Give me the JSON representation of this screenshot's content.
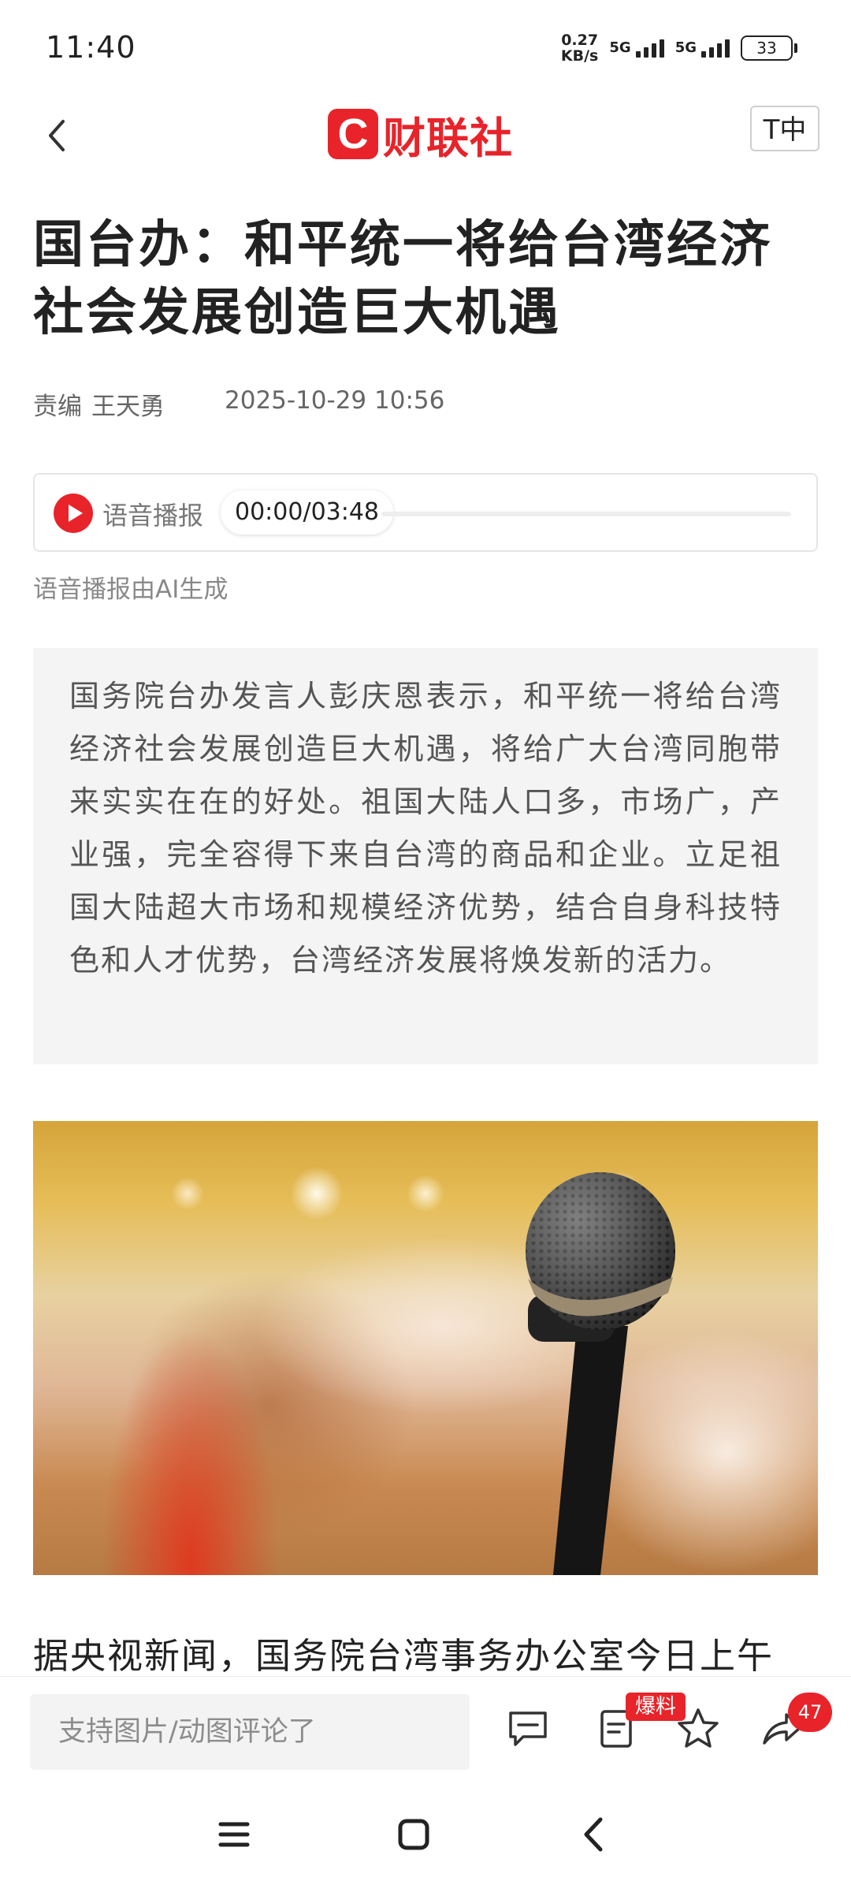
{
  "status_bar": {
    "time": "11:40",
    "net_speed_value": "0.27",
    "net_speed_unit": "KB/s",
    "sim1_label": "5G",
    "sim2_label": "5G",
    "battery": "33"
  },
  "header": {
    "logo_mark": "C",
    "logo_text": "财联社",
    "font_size_button": "T中"
  },
  "article": {
    "title": "国台办：和平统一将给台湾经济社会发展创造巨大机遇",
    "editor_label": "责编",
    "editor_name": "王天勇",
    "datetime": "2025-10-29 10:56",
    "audio": {
      "label": "语音播报",
      "time": "00:00/03:48",
      "progress": 0,
      "ai_note": "语音播报由AI生成"
    },
    "summary": "国务院台办发言人彭庆恩表示，和平统一将给台湾经济社会发展创造巨大机遇，将给广大台湾同胞带来实实在在的好处。祖国大陆人口多，市场广，产业强，完全容得下来自台湾的商品和企业。立足祖国大陆超大市场和规模经济优势，结合自身科技特色和人才优势，台湾经济发展将焕发新的活力。",
    "body_first_line": "据央视新闻，国务院台湾事务办公室今日上午"
  },
  "bottom_bar": {
    "comment_placeholder": "支持图片/动图评论了",
    "report_badge": "爆料",
    "share_count": "47"
  },
  "icons": {
    "back": "chevron-left-icon",
    "comment": "comment-icon",
    "report": "report-icon",
    "favorite": "star-icon",
    "share": "share-icon",
    "nav_menu": "menu-icon",
    "nav_home": "home-icon",
    "nav_back": "back-icon"
  },
  "colors": {
    "brand_red": "#e8232a",
    "summary_bg": "#f4f4f4"
  }
}
